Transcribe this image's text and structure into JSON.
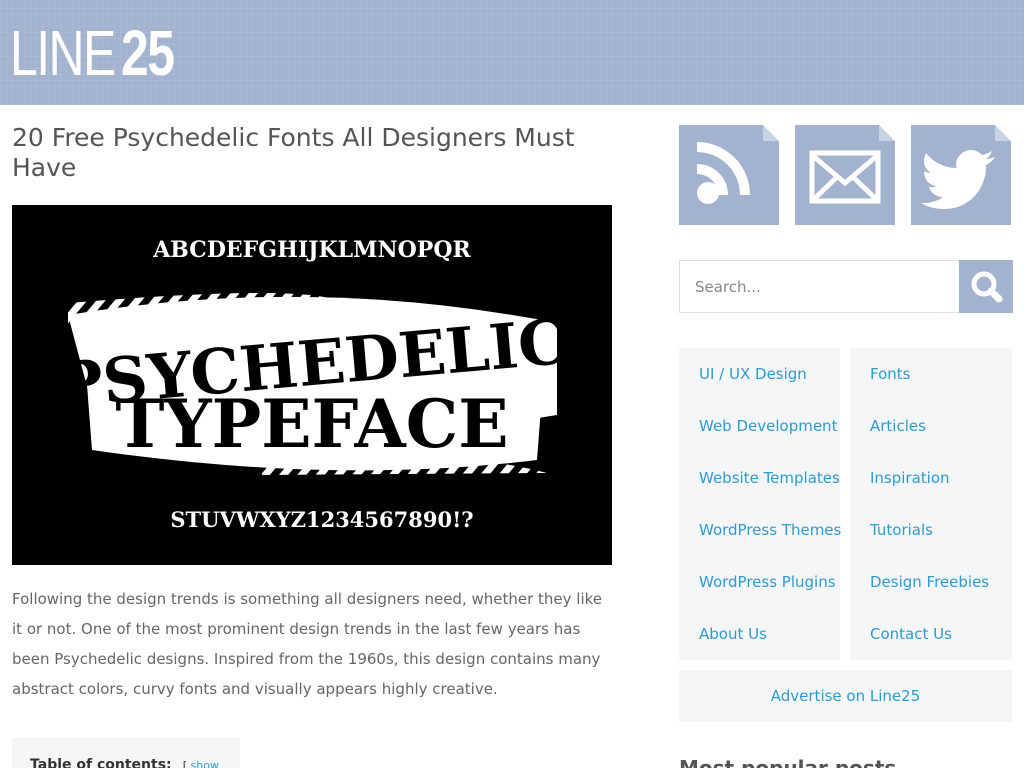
{
  "header": {
    "logo_light": "LINE",
    "logo_bold": "25"
  },
  "post": {
    "title": "20 Free Psychedelic Fonts All Designers Must Have",
    "hero": {
      "top_line": "ABCDEFGHIJKLMNOPQR",
      "word1": "PSYCHEDELIC",
      "word2": "TYPEFACE",
      "bottom_line": "STUVWXYZ1234567890!?"
    },
    "body": "Following the design trends is something all designers need, whether they like it or not. One of the most prominent design trends in the last few years has been Psychedelic designs. Inspired from the 1960s, this design contains many abstract colors, curvy fonts and visually appears highly creative.",
    "toc": {
      "title": "Table of contents:",
      "toggle_open": "[",
      "toggle_label": "show",
      "toggle_close": "]"
    }
  },
  "sidebar": {
    "social": [
      {
        "name": "rss-icon"
      },
      {
        "name": "mail-icon"
      },
      {
        "name": "twitter-icon"
      }
    ],
    "search": {
      "placeholder": "Search..."
    },
    "categories_left": [
      "UI / UX Design",
      "Web Development",
      "Website Templates",
      "WordPress Themes",
      "WordPress Plugins",
      "About Us"
    ],
    "categories_right": [
      "Fonts",
      "Articles",
      "Inspiration",
      "Tutorials",
      "Design Freebies",
      "Contact Us"
    ],
    "advertise": "Advertise on Line25",
    "popular_heading": "Most popular posts"
  },
  "colors": {
    "header_bg": "#a3b3cf",
    "accent_link": "#2e9bd0",
    "panel_bg": "#f5f6f8"
  }
}
